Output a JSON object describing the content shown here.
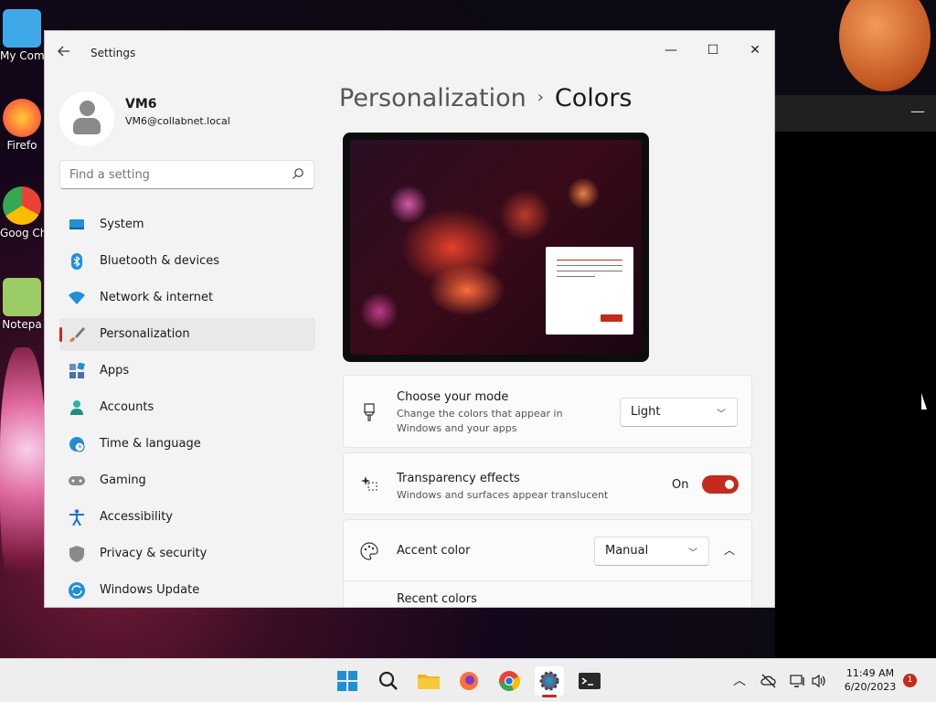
{
  "desktop": {
    "icons": [
      {
        "label": "My Com",
        "icon": "computer-icon",
        "color": "#3fa9e8"
      },
      {
        "label": "Firefo",
        "icon": "firefox-icon",
        "color": "#ff7139"
      },
      {
        "label": "Goog Chron",
        "icon": "chrome-icon",
        "color": "#34a853"
      },
      {
        "label": "Notepa",
        "icon": "notepad-icon",
        "color": "#9ccc65"
      }
    ]
  },
  "window": {
    "app_title": "Settings",
    "controls": {
      "minimize": "—",
      "maximize": "☐",
      "close": "✕"
    }
  },
  "profile": {
    "name": "VM6",
    "email": "VM6@collabnet.local"
  },
  "search": {
    "placeholder": "Find a setting"
  },
  "nav": {
    "items": [
      {
        "label": "System",
        "icon": "system-icon",
        "color": "#1f8fd6"
      },
      {
        "label": "Bluetooth & devices",
        "icon": "bluetooth-icon",
        "color": "#1f8fd6"
      },
      {
        "label": "Network & internet",
        "icon": "wifi-icon",
        "color": "#1f8fd6"
      },
      {
        "label": "Personalization",
        "icon": "brush-icon",
        "color": "#e07b2a"
      },
      {
        "label": "Apps",
        "icon": "apps-icon",
        "color": "#4b6fa6"
      },
      {
        "label": "Accounts",
        "icon": "accounts-icon",
        "color": "#2ab5a0"
      },
      {
        "label": "Time & language",
        "icon": "globe-clock-icon",
        "color": "#1f8fd6"
      },
      {
        "label": "Gaming",
        "icon": "gamepad-icon",
        "color": "#808080"
      },
      {
        "label": "Accessibility",
        "icon": "accessibility-icon",
        "color": "#1f6fd6"
      },
      {
        "label": "Privacy & security",
        "icon": "shield-icon",
        "color": "#808080"
      },
      {
        "label": "Windows Update",
        "icon": "update-icon",
        "color": "#1f8fd6"
      }
    ],
    "active_index": 3
  },
  "breadcrumb": {
    "parent": "Personalization",
    "separator": "›",
    "current": "Colors"
  },
  "settings": {
    "mode": {
      "title": "Choose your mode",
      "description": "Change the colors that appear in Windows and your apps",
      "value": "Light"
    },
    "transparency": {
      "title": "Transparency effects",
      "description": "Windows and surfaces appear translucent",
      "state_label": "On",
      "enabled": true
    },
    "accent": {
      "title": "Accent color",
      "value": "Manual"
    },
    "recent_colors_label": "Recent colors"
  },
  "accent_color": "#c42b1c",
  "taskbar": {
    "apps": [
      {
        "name": "start-button",
        "icon": "windows-icon"
      },
      {
        "name": "search-button",
        "icon": "search-icon"
      },
      {
        "name": "file-explorer-button",
        "icon": "folder-icon"
      },
      {
        "name": "firefox-button",
        "icon": "firefox-icon"
      },
      {
        "name": "chrome-button",
        "icon": "chrome-icon"
      },
      {
        "name": "settings-button",
        "icon": "gear-icon"
      },
      {
        "name": "terminal-button",
        "icon": "terminal-icon"
      }
    ],
    "time": "11:49 AM",
    "date": "6/20/2023",
    "notification_count": "1"
  }
}
